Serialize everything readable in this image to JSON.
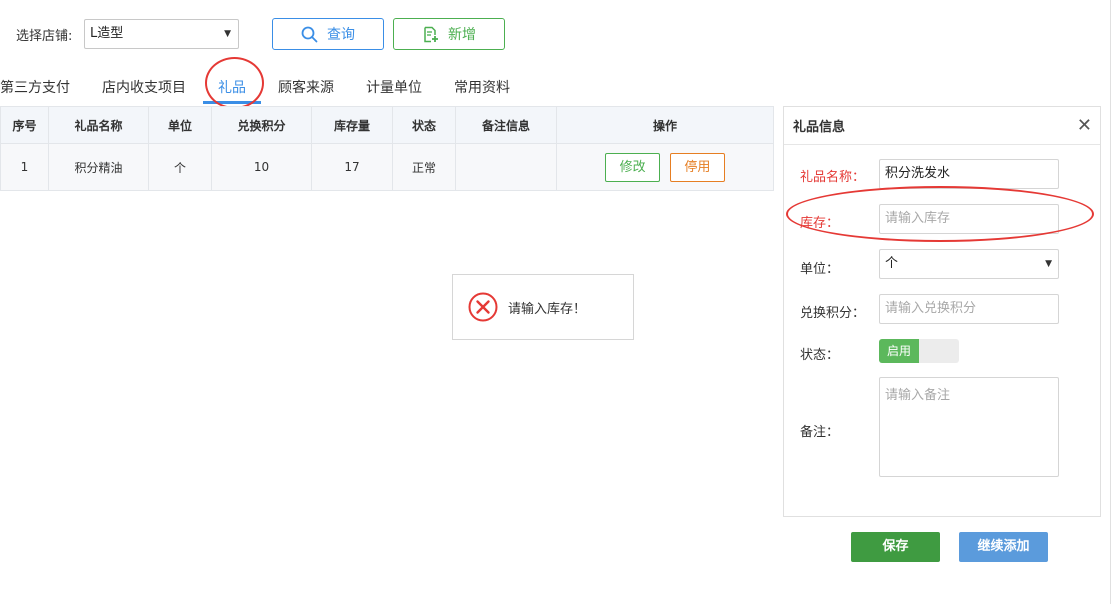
{
  "toolbar": {
    "store_label": "选择店铺:",
    "store_value": "L造型",
    "query_label": "查询",
    "add_label": "新增"
  },
  "tabs": [
    {
      "label": "第三方支付"
    },
    {
      "label": "店内收支项目"
    },
    {
      "label": "礼品",
      "active": true
    },
    {
      "label": "顾客来源"
    },
    {
      "label": "计量单位"
    },
    {
      "label": "常用资料"
    }
  ],
  "table": {
    "headers": [
      "序号",
      "礼品名称",
      "单位",
      "兑换积分",
      "库存量",
      "状态",
      "备注信息",
      "操作"
    ],
    "rows": [
      {
        "index": "1",
        "name": "积分精油",
        "unit": "个",
        "points": "10",
        "stock": "17",
        "status": "正常",
        "note": "",
        "edit_label": "修改",
        "disable_label": "停用"
      }
    ]
  },
  "toast": {
    "message": "请输入库存！"
  },
  "panel": {
    "title": "礼品信息",
    "name_label": "礼品名称：",
    "name_value": "积分洗发水",
    "stock_label": "库存：",
    "stock_placeholder": "请输入库存",
    "unit_label": "单位：",
    "unit_value": "个",
    "points_label": "兑换积分：",
    "points_placeholder": "请输入兑换积分",
    "status_label": "状态：",
    "status_on_label": "启用",
    "note_label": "备注：",
    "note_placeholder": "请输入备注",
    "save_label": "保存",
    "continue_label": "继续添加"
  },
  "colors": {
    "primary": "#3a8ee6",
    "success": "#4caf50",
    "warning": "#e67e22",
    "danger": "#e53935"
  }
}
